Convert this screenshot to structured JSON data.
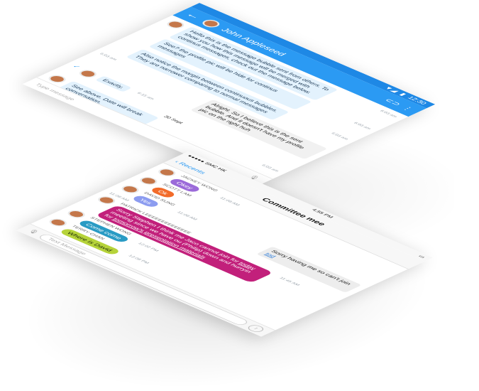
{
  "android": {
    "status": {
      "time": "12:30",
      "icons": [
        "signal-icon",
        "battery-icon"
      ]
    },
    "header": {
      "title": "John Appleseed",
      "back": "←",
      "icons": [
        "link-icon",
        "more-icon"
      ]
    },
    "messages": [
      {
        "text": "Hello this is the message bubble sent from others. To show you how this message will be merged with continus messages, check out the message below.",
        "time": "6:03 am"
      },
      {
        "text": "See? the profile pic will be hide for continus messages",
        "time": "6:03 am"
      },
      {
        "text": "Also notice the margin between continuous bubbles. They are narrower comparing to normal messages",
        "time": "6:03 am"
      }
    ],
    "outgoing": {
      "text": "Alright. So I believe this is the sent bubble. And it doesn't have my profile pic on the right huh",
      "time": "6:03 am"
    },
    "exactly": {
      "text": "Exactly.",
      "time": "6:15 am"
    },
    "date": "30 Sept",
    "see_above": {
      "text": "See above. Date will break conversation.",
      "time": "6:03 am"
    },
    "input_placeholder": "Type message",
    "colors": {
      "accent": "#2b9af3",
      "bubble_in": "#e3f2fd"
    }
  },
  "ios": {
    "status": {
      "carrier": "●●●●● SMC HK",
      "time": "4:55 PM"
    },
    "header": {
      "back": "Recents",
      "title": "Committee mee"
    },
    "messages": [
      {
        "name": "JACKEY WONG",
        "text": "Okey",
        "time": "11:08 AM",
        "color": "#9b6ad9"
      },
      {
        "name": "SCOTT LAM",
        "text": "Ok",
        "time": "",
        "color": "#f26b2a"
      },
      {
        "name": "DAVID SUNG",
        "text": "Yes",
        "time": "11:08 AM",
        "color": "#8c9cf0"
      }
    ],
    "outgoing": {
      "text_a": "Sorry having me so can't join ",
      "link": "tod",
      "time": "11:08 AM"
    },
    "patrick": {
      "name": "PATRICK LEEEEEEEEEEEEEE",
      "text_a": "Sorry Stephen I think me Jaco cannot join for ",
      "link1": "today",
      "text_b": " meeting since we have ou (Philip) down and hurryin for ",
      "link2": "tomorrow's presentation materials",
      "time": "11:45 AM"
    },
    "stephen": {
      "name": "STEPHEN WONG",
      "text": "Come come",
      "time": "12:02 PM"
    },
    "terry": {
      "name": "TERRY CHAN",
      "text": "Where is David",
      "time": "12:08 PM"
    },
    "input_placeholder": "Text Message",
    "colors": {
      "patrick": "#c2207b",
      "stephen": "#2a9bc4",
      "terry": "#b6d33a"
    }
  }
}
